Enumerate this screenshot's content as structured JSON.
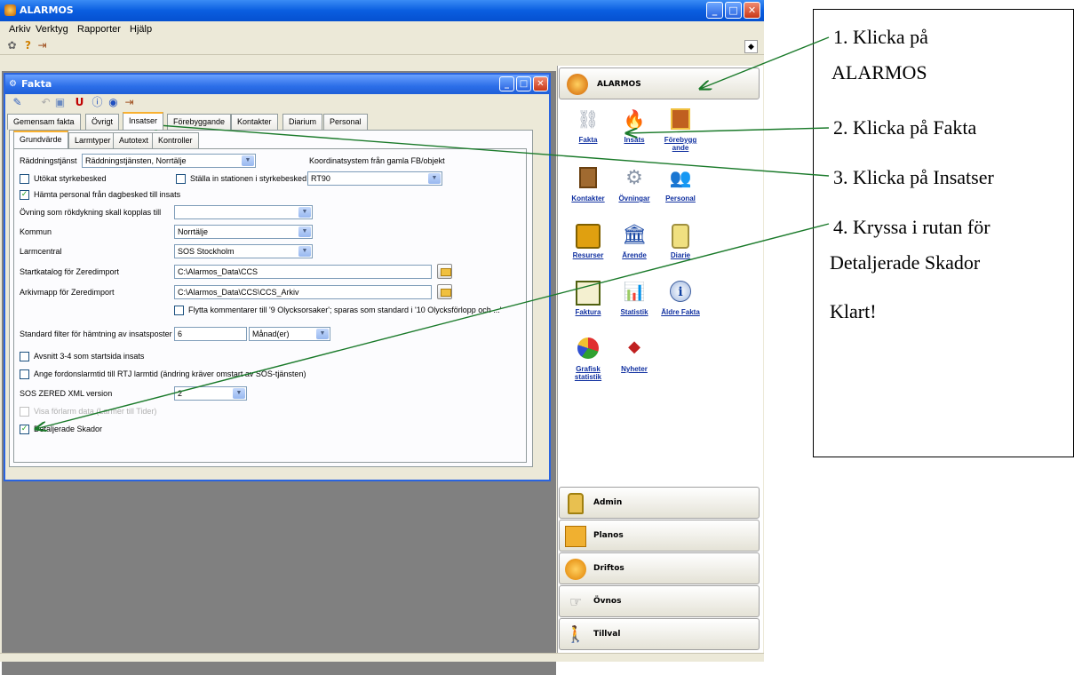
{
  "app": {
    "title": "ALARMOS",
    "menu": [
      "Arkiv",
      "Verktyg",
      "Rapporter",
      "Hjälp"
    ]
  },
  "fakta_window": {
    "title": "Fakta",
    "tabs": [
      "Gemensam fakta",
      "Övrigt",
      "Insatser",
      "Förebyggande",
      "Kontakter",
      "Diarium",
      "Personal"
    ],
    "subtabs": [
      "Grundvärde",
      "Larmtyper",
      "Autotext",
      "Kontroller"
    ],
    "form": {
      "raddning_label": "Räddningstjänst",
      "raddning_value": "Räddningstjänsten, Norrtälje",
      "koord_label": "Koordinatsystem från gamla FB/objekt",
      "koord_value": "RT90",
      "utokat_label": "Utökat styrkebesked",
      "stalla_label": "Ställa in stationen i styrkebesked",
      "hamta_label": "Hämta personal från dagbesked till insats",
      "ovning_label": "Övning som rökdykning skall kopplas till",
      "ovning_value": "",
      "kommun_label": "Kommun",
      "kommun_value": "Norrtälje",
      "larmcentral_label": "Larmcentral",
      "larmcentral_value": "SOS Stockholm",
      "startkatalog_label": "Startkatalog för Zeredimport",
      "startkatalog_value": "C:\\Alarmos_Data\\CCS",
      "arkiv_label": "Arkivmapp för Zeredimport",
      "arkiv_value": "C:\\Alarmos_Data\\CCS\\CCS_Arkiv",
      "flytta_label": "Flytta kommentarer till '9 Olycksorsaker'; sparas som standard i '10 Olycksförlopp och ...'",
      "standard_filter_label": "Standard filter för hämtning av insatsposter",
      "standard_filter_value": "6",
      "standard_filter_unit": "Månad(er)",
      "avsnitt_label": "Avsnitt 3-4 som startsida insats",
      "ange_label": "Ange fordonslarmtid till RTJ larmtid (ändring kräver omstart av SOS-tjänsten)",
      "sos_label": "SOS ZERED XML version",
      "sos_value": "2",
      "visa_label": "Visa förlarm data (Larmer till Tider)",
      "detaljerade_label": "Detaljerade Skador"
    }
  },
  "right_panel": {
    "alarmos_button": "ALARMOS",
    "tiles": [
      {
        "label": "Fakta",
        "icon": "chains-icon"
      },
      {
        "label": "Insats",
        "icon": "fire-icon"
      },
      {
        "label": "Förebygg ande",
        "icon": "house-icon"
      },
      {
        "label": "Kontakter",
        "icon": "book-icon"
      },
      {
        "label": "Övningar",
        "icon": "gear-icon"
      },
      {
        "label": "Personal",
        "icon": "people-icon"
      },
      {
        "label": "Resurser",
        "icon": "truck-icon"
      },
      {
        "label": "Ärende",
        "icon": "building-icon"
      },
      {
        "label": "Diarie",
        "icon": "bag-icon"
      },
      {
        "label": "Faktura",
        "icon": "invoice-icon"
      },
      {
        "label": "Statistik",
        "icon": "bar-chart-icon"
      },
      {
        "label": "Äldre Fakta",
        "icon": "info-icon"
      },
      {
        "label": "Grafisk statistik",
        "icon": "pie-chart-icon"
      },
      {
        "label": "Nyheter",
        "icon": "news-icon"
      }
    ],
    "nav_buttons": [
      "Admin",
      "Planos",
      "Driftos",
      "Övnos",
      "Tillval"
    ]
  },
  "callout": {
    "step1_line1": "1. Klicka på",
    "step1_line2": "ALARMOS",
    "step2": "2. Klicka på Fakta",
    "step3": "3. Klicka på Insatser",
    "step4_line1": "4. Kryssa i rutan för",
    "step4_line2": "Detaljerade Skador",
    "done": "Klart!"
  }
}
